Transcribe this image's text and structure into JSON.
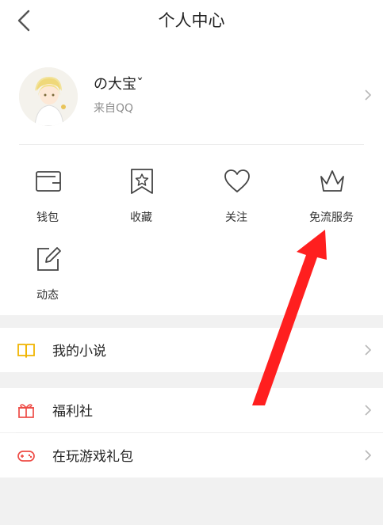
{
  "header": {
    "title": "个人中心"
  },
  "profile": {
    "name": "の大宝ˇ",
    "source": "来自QQ"
  },
  "grid": [
    {
      "label": "钱包",
      "icon": "wallet-icon"
    },
    {
      "label": "收藏",
      "icon": "bookmark-star-icon"
    },
    {
      "label": "关注",
      "icon": "heart-icon"
    },
    {
      "label": "免流服务",
      "icon": "crown-icon"
    },
    {
      "label": "动态",
      "icon": "edit-icon"
    }
  ],
  "menu": [
    {
      "label": "我的小说",
      "icon": "book-icon"
    },
    {
      "label": "福利社",
      "icon": "gift-icon"
    },
    {
      "label": "在玩游戏礼包",
      "icon": "gamepad-icon"
    }
  ],
  "colors": {
    "book": "#f0b400",
    "gift": "#ee4c46",
    "annotation_arrow": "#ff1f1f"
  }
}
